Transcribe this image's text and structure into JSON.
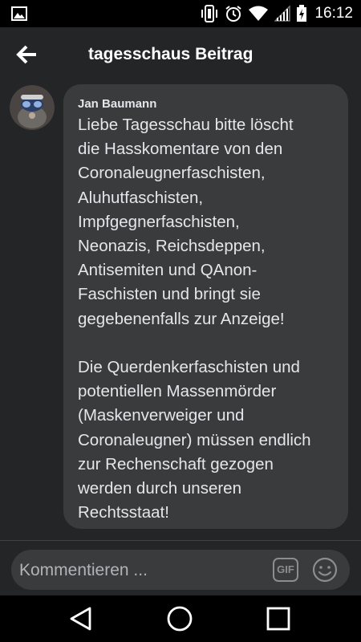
{
  "status_bar": {
    "time": "16:12",
    "icons": [
      "image-icon",
      "vibrate-icon",
      "alarm-icon",
      "wifi-icon",
      "signal-icon",
      "battery-icon"
    ]
  },
  "header": {
    "title": "tagesschaus Beitrag",
    "back_icon": "arrow-left-icon"
  },
  "comment": {
    "author": "Jan Baumann",
    "text": "Liebe Tagesschau bitte löscht\ndie Hasskomentare von den\nCoronaleugnerfaschisten,\nAluhutfaschisten,\nImpfgegnerfaschisten,\nNeonazis, Reichsdeppen,\nAntisemiten und QAnon-\nFaschisten und bringt sie\ngegebenenfalls zur Anzeige!\n\nDie Querdenkerfaschisten und\npotentiellen Massenmörder\n(Maskenverweiger und\nCoronaleugner) müssen endlich\nzur Rechenschaft gezogen\nwerden durch unseren\nRechtsstaat!"
  },
  "composer": {
    "placeholder": "Kommentieren ...",
    "gif_label": "GIF",
    "emoji_icon": "emoji-icon"
  },
  "nav_bar": {
    "icons": [
      "back-triangle-icon",
      "home-circle-icon",
      "recents-square-icon"
    ]
  },
  "colors": {
    "background": "#242526",
    "bubble": "#3a3b3c",
    "text": "#e4e6eb",
    "placeholder": "#b0b3b8",
    "system_bar": "#000000"
  }
}
